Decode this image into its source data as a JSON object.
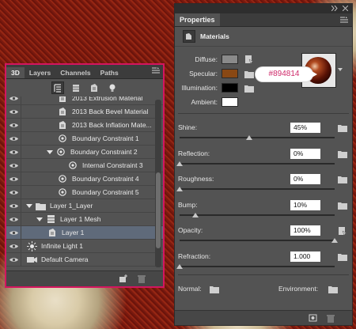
{
  "layers_panel": {
    "tabs": [
      "3D",
      "Layers",
      "Channels",
      "Paths"
    ],
    "rows": [
      {
        "label": "2013 Extrusion Material",
        "indent": 3,
        "icon": "material-icon",
        "arrow": ""
      },
      {
        "label": "2013 Back Bevel Material",
        "indent": 3,
        "icon": "material-icon",
        "arrow": ""
      },
      {
        "label": "2013 Back Inflation Mate...",
        "indent": 3,
        "icon": "material-icon",
        "arrow": ""
      },
      {
        "label": "Boundary Constraint 1",
        "indent": 3,
        "icon": "constraint-icon",
        "arrow": ""
      },
      {
        "label": "Boundary Constraint 2",
        "indent": 2,
        "icon": "constraint-icon",
        "arrow": "down"
      },
      {
        "label": "Internal Constraint 3",
        "indent": 4,
        "icon": "constraint-icon",
        "arrow": ""
      },
      {
        "label": "Boundary Constraint 4",
        "indent": 3,
        "icon": "constraint-icon",
        "arrow": ""
      },
      {
        "label": "Boundary Constraint 5",
        "indent": 3,
        "icon": "constraint-icon",
        "arrow": ""
      },
      {
        "label": "Layer 1_Layer",
        "indent": 0,
        "icon": "folder-icon",
        "arrow": "down"
      },
      {
        "label": "Layer 1 Mesh",
        "indent": 1,
        "icon": "mesh-icon",
        "arrow": "down"
      },
      {
        "label": "Layer 1",
        "indent": 2,
        "icon": "material-icon",
        "arrow": "",
        "selected": true
      },
      {
        "label": "Infinite Light 1",
        "indent": 0,
        "icon": "light-icon",
        "arrow": ""
      },
      {
        "label": "Default Camera",
        "indent": 0,
        "icon": "camera-icon",
        "arrow": ""
      }
    ]
  },
  "properties_panel": {
    "title": "Properties",
    "section": "Materials",
    "swatches": [
      {
        "label": "Diffuse:",
        "color": "#8a8a8a"
      },
      {
        "label": "Specular:",
        "color": "#894814"
      },
      {
        "label": "Illumination:",
        "color": "#000000"
      },
      {
        "label": "Ambient:",
        "color": "#ffffff"
      }
    ],
    "color_callout": "#894814",
    "params": [
      {
        "label": "Shine:",
        "value": "45%",
        "level": 0.45
      },
      {
        "label": "Reflection:",
        "value": "0%",
        "level": 0.0
      },
      {
        "label": "Roughness:",
        "value": "0%",
        "level": 0.0
      },
      {
        "label": "Bump:",
        "value": "10%",
        "level": 0.1
      },
      {
        "label": "Opacity:",
        "value": "100%",
        "level": 1.0
      },
      {
        "label": "Refraction:",
        "value": "1.000",
        "level": 0.0
      }
    ],
    "normal_label": "Normal:",
    "environment_label": "Environment:"
  }
}
